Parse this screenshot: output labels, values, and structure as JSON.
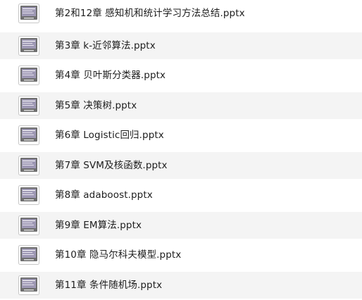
{
  "icon": {
    "name": "pptx-file-icon",
    "frame_color": "#6f6f6f",
    "screen_color": "#9e98b4",
    "border_color": "#c8c8c8"
  },
  "files": [
    {
      "name": "第2和12章 感知机和统计学习方法总结.pptx"
    },
    {
      "name": "第3章 k-近邻算法.pptx"
    },
    {
      "name": "第4章 贝叶斯分类器.pptx"
    },
    {
      "name": "第5章 决策树.pptx"
    },
    {
      "name": "第6章 Logistic回归.pptx"
    },
    {
      "name": "第7章 SVM及核函数.pptx"
    },
    {
      "name": "第8章 adaboost.pptx"
    },
    {
      "name": "第9章 EM算法.pptx"
    },
    {
      "name": "第10章 隐马尔科夫模型.pptx"
    },
    {
      "name": "第11章 条件随机场.pptx"
    }
  ]
}
